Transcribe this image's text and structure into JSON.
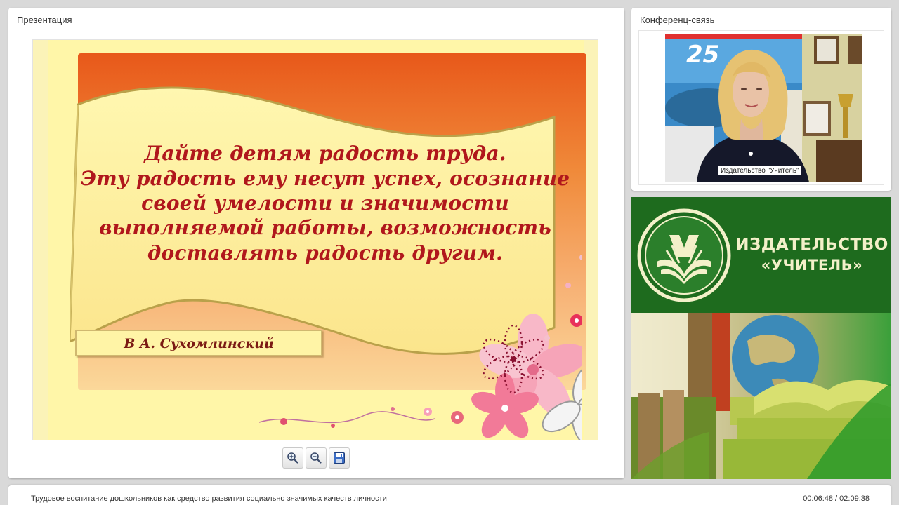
{
  "presentation": {
    "title": "Презентация",
    "slide": {
      "quote_lines": [
        "Дайте детям радость труда.",
        "Эту радость ему несут успех, осознание",
        "своей умелости и значимости",
        "выполняемой работы, возможность",
        "доставлять радость другим."
      ],
      "author": "В А. Сухомлинский"
    },
    "toolbar": {
      "zoom_in": "zoom-in-icon",
      "zoom_out": "zoom-out-icon",
      "save": "save-icon"
    }
  },
  "conference": {
    "title": "Конференц-связь",
    "speaker_label": "Издательство \"Учитель\""
  },
  "publisher_ad": {
    "line1": "ИЗДАТЕЛЬСТВО",
    "line2": "«УЧИТЕЛЬ»",
    "accent": "#1e6b1e"
  },
  "footer": {
    "title": "Трудовое воспитание дошкольников как средство развития социально значимых качеств личности",
    "time": "00:06:48 / 02:09:38"
  }
}
